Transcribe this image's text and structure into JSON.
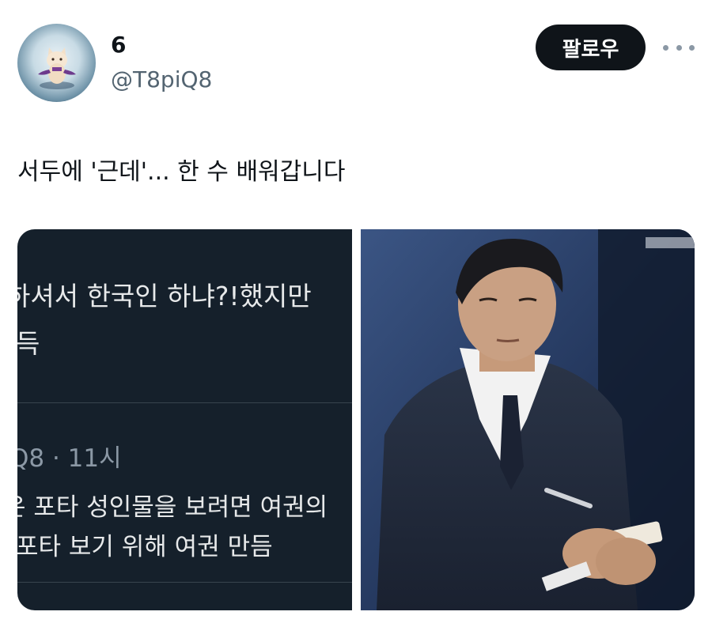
{
  "user": {
    "display_name": "6",
    "handle": "@T8piQ8",
    "avatar_alt": "avatar"
  },
  "follow_button": {
    "label": "팔로우"
  },
  "more_icon": "more-horizontal-icon",
  "tweet": {
    "text": "서두에 '근데'... 한 수 배워갑니다"
  },
  "media": {
    "screenshot": {
      "line1": "하셔서 한국인 하냐?!했지만",
      "line2": "득",
      "meta": "Q8 · 11시",
      "body1": "은 포타 성인물을 보려면 여권의",
      "body2": "포타 보기 위해 여권 만듬"
    },
    "photo_alt": "man in suit writing notes on a small notepad"
  },
  "colors": {
    "text_primary": "#0f1419",
    "text_secondary": "#536471",
    "follow_bg": "#0f1419",
    "dark_card_bg": "#15202b"
  }
}
